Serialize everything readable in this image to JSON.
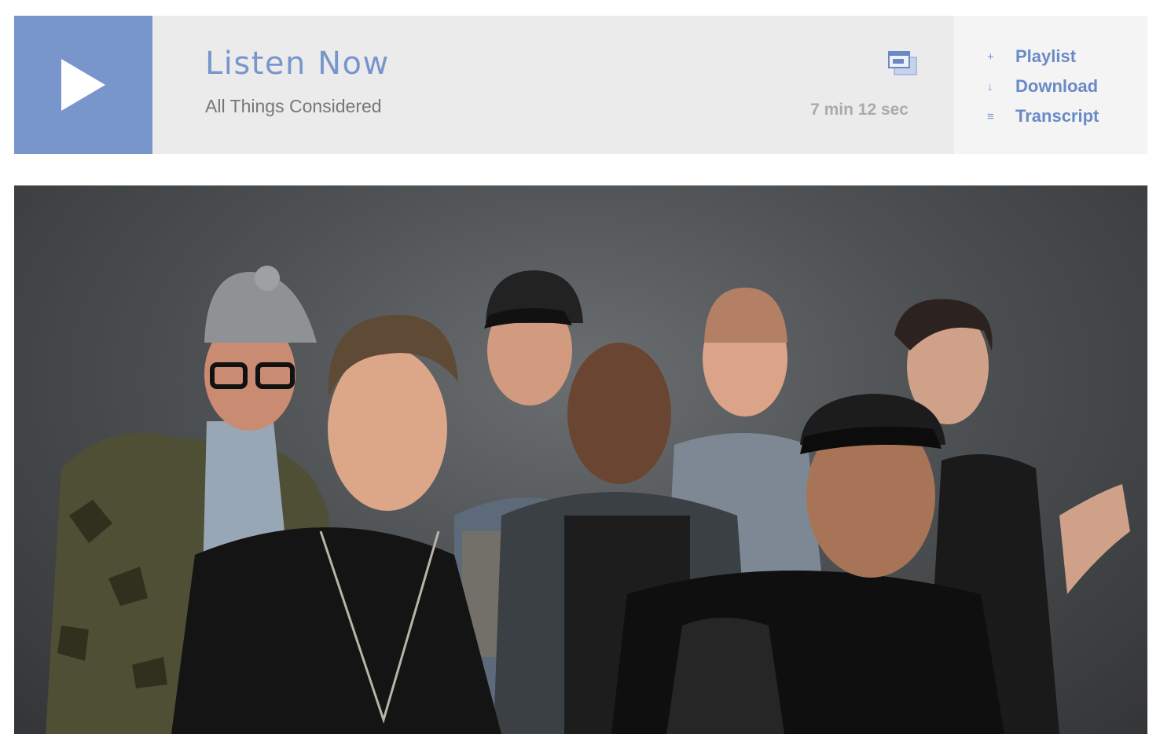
{
  "player": {
    "title": "Listen Now",
    "program": "All Things Considered",
    "duration": "7 min 12 sec",
    "accent_color": "#7896cc",
    "play_icon": "play-icon",
    "popout_icon": "popout-window-icon",
    "actions": [
      {
        "icon": "+",
        "label": "Playlist"
      },
      {
        "icon": "↓",
        "label": "Download"
      },
      {
        "icon": "≡",
        "label": "Transcript"
      }
    ]
  },
  "photo": {
    "subject": "band-portrait"
  }
}
